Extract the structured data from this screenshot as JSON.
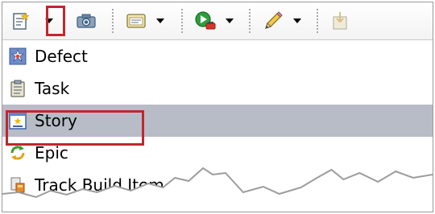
{
  "toolbar": {
    "buttons": [
      {
        "name": "new-work-item",
        "icon": "new-document-icon",
        "has_dropdown": true
      },
      {
        "name": "snapshot",
        "icon": "camera-icon",
        "has_dropdown": false
      },
      {
        "name": "view",
        "icon": "window-icon",
        "has_dropdown": true
      },
      {
        "name": "run",
        "icon": "play-icon",
        "has_dropdown": true
      },
      {
        "name": "edit",
        "icon": "pencil-icon",
        "has_dropdown": true
      },
      {
        "name": "import",
        "icon": "import-icon",
        "has_dropdown": false
      }
    ]
  },
  "menu": {
    "items": [
      {
        "label": "Defect",
        "icon": "defect-icon"
      },
      {
        "label": "Task",
        "icon": "task-icon"
      },
      {
        "label": "Story",
        "icon": "story-icon",
        "selected": true
      },
      {
        "label": "Epic",
        "icon": "epic-icon"
      },
      {
        "label": "Track Build Item",
        "icon": "track-build-icon"
      }
    ]
  },
  "colors": {
    "highlight": "#c0272d",
    "selection": "#b7bcc7"
  }
}
